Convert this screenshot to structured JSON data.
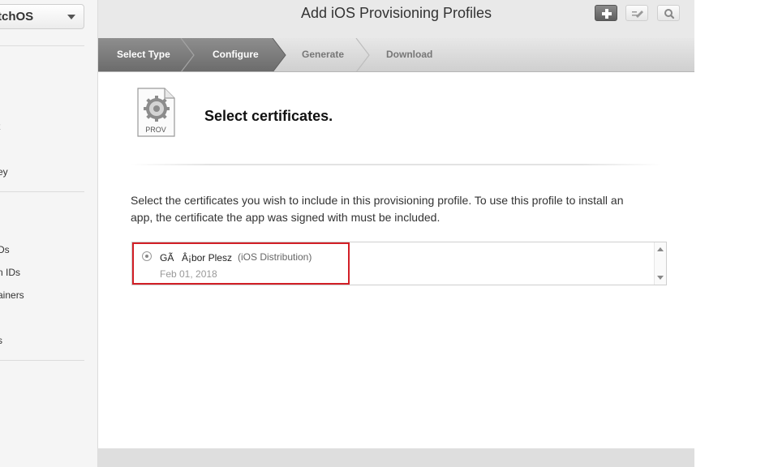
{
  "sidebar": {
    "platform": "watchOS",
    "items": [
      {
        "label": "t"
      },
      {
        "label": "ey"
      },
      {
        "label": "Ds"
      },
      {
        "label": "n IDs"
      },
      {
        "label": "ainers"
      },
      {
        "label": "s"
      }
    ]
  },
  "header": {
    "title": "Add iOS Provisioning Profiles",
    "icons": [
      "add-icon",
      "edit-icon",
      "search-icon"
    ]
  },
  "steps": [
    {
      "label": "Select Type",
      "state": "done"
    },
    {
      "label": "Configure",
      "state": "active"
    },
    {
      "label": "Generate",
      "state": "inactive"
    },
    {
      "label": "Download",
      "state": "inactive"
    }
  ],
  "content": {
    "icon_label": "PROV",
    "heading": "Select certificates.",
    "description": "Select the certificates you wish to include in this provisioning profile. To use this profile to install an app, the certificate the app was signed with must be included.",
    "certificates": [
      {
        "name": "GÃÂ¡bor Plesz",
        "type": "(iOS Distribution)",
        "date": "Feb 01, 2018",
        "selected": false,
        "highlight_color": "#d21f26"
      }
    ]
  },
  "colors": {
    "accent": "#7a7a7a",
    "highlight": "#d21f26"
  }
}
